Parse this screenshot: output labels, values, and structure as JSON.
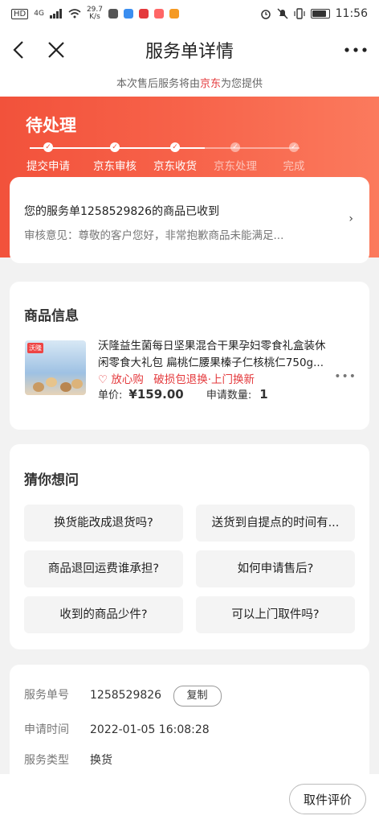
{
  "status_bar": {
    "left_badges": [
      "HD",
      "4G"
    ],
    "net_speed": "29.7",
    "net_unit": "K/s",
    "time": "11:56",
    "battery_level": 0.9
  },
  "nav": {
    "title": "服务单详情",
    "back_icon": "chevron-left-icon",
    "close_icon": "close-icon",
    "more_icon": "more-icon"
  },
  "notice": {
    "prefix": "本次售后服务将由",
    "brand": "京东",
    "suffix": "为您提供"
  },
  "order_status": {
    "title": "待处理",
    "steps": [
      {
        "label": "提交申请",
        "done": true
      },
      {
        "label": "京东审核",
        "done": true
      },
      {
        "label": "京东收货",
        "done": true
      },
      {
        "label": "京东处理",
        "done": false
      },
      {
        "label": "完成",
        "done": false
      }
    ]
  },
  "message": {
    "main": "您的服务单1258529826的商品已收到",
    "sub": "审核意见：尊敬的客户您好，非常抱歉商品未能满足..."
  },
  "goods": {
    "section_title": "商品信息",
    "image_tag": "沃隆",
    "name_line1": "沃隆益生菌每日坚果混合干果孕妇零食礼盒装休",
    "name_line2": "闲零食大礼包 扁桃仁腰果榛子仁核桃仁750g...",
    "tag_fangxingou": "放心购",
    "tag_service": "破损包退换·上门换新",
    "price_label": "单价:",
    "price": "¥159.00",
    "qty_label": "申请数量:",
    "qty": "1"
  },
  "faq": {
    "section_title": "猜你想问",
    "questions": [
      "换货能改成退货吗?",
      "送货到自提点的时间有...",
      "商品退回运费谁承担?",
      "如何申请售后?",
      "收到的商品少件?",
      "可以上门取件吗?"
    ]
  },
  "info": {
    "order_no_label": "服务单号",
    "order_no": "1258529826",
    "copy_label": "复制",
    "apply_time_label": "申请时间",
    "apply_time": "2022-01-05 16:08:28",
    "service_type_label": "服务类型",
    "service_type": "换货"
  },
  "bottom": {
    "evaluate_label": "取件评价"
  },
  "colors": {
    "accent": "#e4393c",
    "header_gradient_start": "#f2523b",
    "header_gradient_end": "#fb7a5d"
  }
}
